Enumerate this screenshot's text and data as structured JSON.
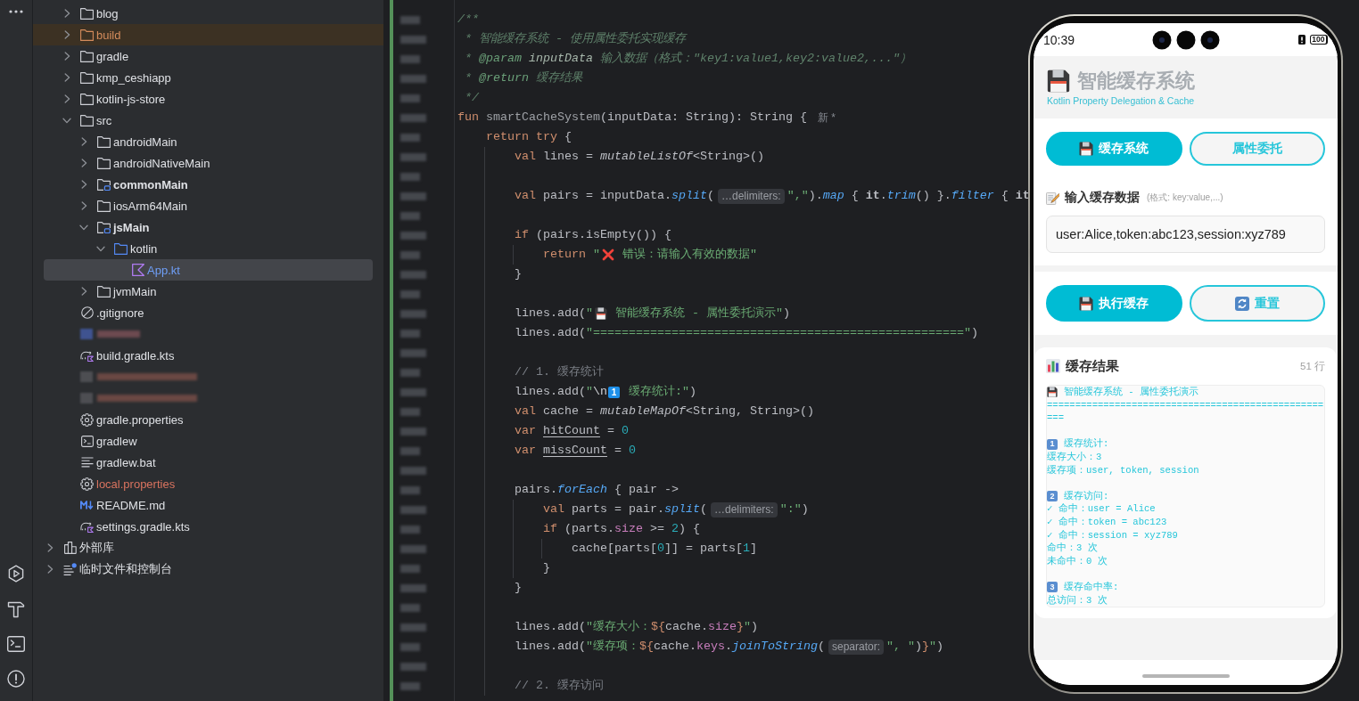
{
  "project_tree": {
    "project_contents": [
      {
        "label": "blog",
        "kind": "folder",
        "expanded": false,
        "selected": false,
        "highlighted": false
      },
      {
        "label": "build",
        "kind": "folder",
        "expanded": false,
        "selected": false,
        "highlighted": true,
        "color": "#d58c5c"
      },
      {
        "label": "gradle",
        "kind": "folder",
        "expanded": false,
        "selected": false,
        "highlighted": false
      },
      {
        "label": "kmp_ceshiapp",
        "kind": "folder",
        "expanded": false,
        "selected": false,
        "highlighted": false
      },
      {
        "label": "kotlin-js-store",
        "kind": "folder",
        "expanded": false,
        "selected": false,
        "highlighted": false
      },
      {
        "label": "src",
        "kind": "folder",
        "expanded": true,
        "selected": false,
        "highlighted": false,
        "children": [
          {
            "label": "androidMain",
            "kind": "folder",
            "expanded": false,
            "selected": false,
            "highlighted": false
          },
          {
            "label": "androidNativeMain",
            "kind": "folder",
            "expanded": false,
            "selected": false,
            "highlighted": false
          },
          {
            "label": "commonMain",
            "kind": "source_root",
            "expanded": false,
            "selected": false,
            "highlighted": false
          },
          {
            "label": "iosArm64Main",
            "kind": "folder",
            "expanded": false,
            "selected": false,
            "highlighted": false
          },
          {
            "label": "jsMain",
            "kind": "source_root",
            "expanded": true,
            "selected": false,
            "highlighted": false,
            "children": [
              {
                "label": "kotlin",
                "kind": "kotlin_folder",
                "expanded": true,
                "selected": false,
                "highlighted": false,
                "children": [
                  {
                    "label": "App.kt",
                    "kind": "kotlin_file",
                    "selected": true,
                    "highlighted": false,
                    "color": "#6f9ff8"
                  }
                ]
              }
            ]
          },
          {
            "label": "jvmMain",
            "kind": "folder",
            "expanded": false,
            "selected": false,
            "highlighted": false
          }
        ]
      },
      {
        "label": ".gitignore",
        "kind": "ignore_file",
        "selected": false,
        "highlighted": false
      },
      {
        "kind": "redacted",
        "selected": false,
        "highlighted": false
      },
      {
        "label": "build.gradle.kts",
        "kind": "gradle_script",
        "selected": false,
        "highlighted": false
      },
      {
        "kind": "redacted",
        "selected": false,
        "highlighted": false
      },
      {
        "kind": "redacted",
        "selected": false,
        "highlighted": false
      },
      {
        "label": "gradle.properties",
        "kind": "properties",
        "selected": false,
        "highlighted": false
      },
      {
        "label": "gradlew",
        "kind": "shell_script",
        "selected": false,
        "highlighted": false
      },
      {
        "label": "gradlew.bat",
        "kind": "batch_file",
        "selected": false,
        "highlighted": false
      },
      {
        "label": "local.properties",
        "kind": "properties",
        "selected": false,
        "highlighted": false,
        "color": "#d9735f"
      },
      {
        "label": "README.md",
        "kind": "markdown",
        "selected": false,
        "highlighted": false
      },
      {
        "label": "settings.gradle.kts",
        "kind": "gradle_script",
        "selected": false,
        "highlighted": false
      }
    ],
    "items": [
      {
        "label": "外部库",
        "kind": "library",
        "expanded": false,
        "selected": false,
        "highlighted": false
      },
      {
        "label": "临时文件和控制台",
        "kind": "scratches",
        "expanded": false,
        "selected": false,
        "highlighted": false
      }
    ]
  },
  "editor": {
    "lines": [
      {
        "kind": "code",
        "segments": [
          {
            "kind": "doc",
            "text": "/**"
          }
        ]
      },
      {
        "kind": "code",
        "segments": [
          {
            "kind": "doc",
            "text": " * 智能缓存系统 - 使用属性委托实现缓存"
          }
        ]
      },
      {
        "kind": "code",
        "segments": [
          {
            "kind": "doc",
            "text": " * "
          },
          {
            "kind": "doc_tag",
            "text": "@param "
          },
          {
            "kind": "doc_param",
            "text": "inputData"
          },
          {
            "kind": "doc",
            "text": " 输入数据（格式：\"key1:value1,key2:value2,...\"）"
          }
        ]
      },
      {
        "kind": "code",
        "segments": [
          {
            "kind": "doc",
            "text": " * "
          },
          {
            "kind": "doc_tag",
            "text": "@return"
          },
          {
            "kind": "doc",
            "text": " 缓存结果"
          }
        ]
      },
      {
        "kind": "code",
        "segments": [
          {
            "kind": "doc",
            "text": " */"
          }
        ]
      },
      {
        "kind": "code",
        "segments": [
          {
            "kind": "keyword",
            "text": "fun "
          },
          {
            "kind": "fn_decl",
            "text": "smartCacheSystem"
          },
          {
            "kind": "plain",
            "text": "(inputData: String): String {"
          },
          {
            "kind": "vision",
            "text": "新 *"
          }
        ]
      },
      {
        "kind": "code",
        "segments": [
          {
            "kind": "keyword",
            "text": "    return try"
          },
          {
            "kind": "plain",
            "text": " {"
          }
        ]
      },
      {
        "kind": "code",
        "segments": [
          {
            "kind": "keyword",
            "text": "        val"
          },
          {
            "kind": "plain",
            "text": " lines = "
          },
          {
            "kind": "std_call",
            "text": "mutableListOf"
          },
          {
            "kind": "plain",
            "text": "<String>()"
          }
        ]
      },
      {
        "kind": "blank"
      },
      {
        "kind": "code",
        "segments": [
          {
            "kind": "keyword",
            "text": "        val"
          },
          {
            "kind": "plain",
            "text": " pairs = inputData."
          },
          {
            "kind": "call",
            "text": "split"
          },
          {
            "kind": "plain",
            "text": "("
          },
          {
            "kind": "hint",
            "text": "…delimiters:"
          },
          {
            "kind": "string",
            "text": "\",\""
          },
          {
            "kind": "plain",
            "text": ")."
          },
          {
            "kind": "call",
            "text": "map"
          },
          {
            "kind": "plain",
            "text": " { "
          },
          {
            "kind": "it",
            "text": "it"
          },
          {
            "kind": "plain",
            "text": "."
          },
          {
            "kind": "call",
            "text": "trim"
          },
          {
            "kind": "plain",
            "text": "() }."
          },
          {
            "kind": "call",
            "text": "filter"
          },
          {
            "kind": "plain",
            "text": " { "
          },
          {
            "kind": "it",
            "text": "it"
          }
        ]
      },
      {
        "kind": "blank"
      },
      {
        "kind": "code",
        "segments": [
          {
            "kind": "keyword",
            "text": "        if"
          },
          {
            "kind": "plain",
            "text": " (pairs.isEmpty()) {"
          }
        ]
      },
      {
        "kind": "code",
        "segments": [
          {
            "kind": "keyword",
            "text": "            return "
          },
          {
            "kind": "string",
            "text": "\""
          },
          {
            "kind": "cross"
          },
          {
            "kind": "string",
            "text": " 错误：请输入有效的数据\""
          }
        ]
      },
      {
        "kind": "code",
        "segments": [
          {
            "kind": "plain",
            "text": "        }"
          }
        ]
      },
      {
        "kind": "blank"
      },
      {
        "kind": "code",
        "segments": [
          {
            "kind": "plain",
            "text": "        lines.add("
          },
          {
            "kind": "string",
            "text": "\""
          },
          {
            "kind": "floppy"
          },
          {
            "kind": "string",
            "text": " 智能缓存系统 - 属性委托演示\""
          },
          {
            "kind": "plain",
            "text": ")"
          }
        ]
      },
      {
        "kind": "code",
        "segments": [
          {
            "kind": "plain",
            "text": "        lines.add("
          },
          {
            "kind": "string",
            "text": "\"====================================================\""
          },
          {
            "kind": "plain",
            "text": ")"
          }
        ]
      },
      {
        "kind": "blank"
      },
      {
        "kind": "code",
        "segments": [
          {
            "kind": "comment",
            "text": "        // 1. 缓存统计"
          }
        ]
      },
      {
        "kind": "code",
        "segments": [
          {
            "kind": "plain",
            "text": "        lines.add("
          },
          {
            "kind": "string",
            "text": "\""
          },
          {
            "kind": "escape",
            "text": "\\n"
          },
          {
            "kind": "keycap",
            "text": "1"
          },
          {
            "kind": "string",
            "text": " 缓存统计:\""
          },
          {
            "kind": "plain",
            "text": ")"
          }
        ]
      },
      {
        "kind": "code",
        "segments": [
          {
            "kind": "keyword",
            "text": "        val"
          },
          {
            "kind": "plain",
            "text": " cache = "
          },
          {
            "kind": "std_call",
            "text": "mutableMapOf"
          },
          {
            "kind": "plain",
            "text": "<String, String>()"
          }
        ]
      },
      {
        "kind": "code",
        "segments": [
          {
            "kind": "keyword",
            "text": "        var "
          },
          {
            "kind": "mut_var",
            "text": "hitCount"
          },
          {
            "kind": "plain",
            "text": " = "
          },
          {
            "kind": "number",
            "text": "0"
          }
        ]
      },
      {
        "kind": "code",
        "segments": [
          {
            "kind": "keyword",
            "text": "        var "
          },
          {
            "kind": "mut_var",
            "text": "missCount"
          },
          {
            "kind": "plain",
            "text": " = "
          },
          {
            "kind": "number",
            "text": "0"
          }
        ]
      },
      {
        "kind": "blank"
      },
      {
        "kind": "code",
        "segments": [
          {
            "kind": "plain",
            "text": "        pairs."
          },
          {
            "kind": "call",
            "text": "forEach"
          },
          {
            "kind": "plain",
            "text": " { pair ->"
          }
        ]
      },
      {
        "kind": "code",
        "segments": [
          {
            "kind": "keyword",
            "text": "            val"
          },
          {
            "kind": "plain",
            "text": " parts = pair."
          },
          {
            "kind": "call",
            "text": "split"
          },
          {
            "kind": "plain",
            "text": "("
          },
          {
            "kind": "hint",
            "text": "…delimiters:"
          },
          {
            "kind": "string",
            "text": "\":\""
          },
          {
            "kind": "plain",
            "text": ")"
          }
        ]
      },
      {
        "kind": "code",
        "segments": [
          {
            "kind": "keyword",
            "text": "            if"
          },
          {
            "kind": "plain",
            "text": " (parts."
          },
          {
            "kind": "prop",
            "text": "size"
          },
          {
            "kind": "plain",
            "text": " >= "
          },
          {
            "kind": "number",
            "text": "2"
          },
          {
            "kind": "plain",
            "text": ") {"
          }
        ]
      },
      {
        "kind": "code",
        "segments": [
          {
            "kind": "plain",
            "text": "                cache[parts["
          },
          {
            "kind": "number",
            "text": "0"
          },
          {
            "kind": "plain",
            "text": "]] = parts["
          },
          {
            "kind": "number",
            "text": "1"
          },
          {
            "kind": "plain",
            "text": "]"
          }
        ]
      },
      {
        "kind": "code",
        "segments": [
          {
            "kind": "plain",
            "text": "            }"
          }
        ]
      },
      {
        "kind": "code",
        "segments": [
          {
            "kind": "plain",
            "text": "        }"
          }
        ]
      },
      {
        "kind": "blank"
      },
      {
        "kind": "code",
        "segments": [
          {
            "kind": "plain",
            "text": "        lines.add("
          },
          {
            "kind": "string",
            "text": "\"缓存大小："
          },
          {
            "kind": "template",
            "text": "${"
          },
          {
            "kind": "plain",
            "text": "cache."
          },
          {
            "kind": "prop",
            "text": "size"
          },
          {
            "kind": "template",
            "text": "}"
          },
          {
            "kind": "string",
            "text": "\""
          },
          {
            "kind": "plain",
            "text": ")"
          }
        ]
      },
      {
        "kind": "code",
        "segments": [
          {
            "kind": "plain",
            "text": "        lines.add("
          },
          {
            "kind": "string",
            "text": "\"缓存项："
          },
          {
            "kind": "template",
            "text": "${"
          },
          {
            "kind": "plain",
            "text": "cache."
          },
          {
            "kind": "prop",
            "text": "keys"
          },
          {
            "kind": "plain",
            "text": "."
          },
          {
            "kind": "call",
            "text": "joinToString"
          },
          {
            "kind": "plain",
            "text": "("
          },
          {
            "kind": "hint",
            "text": "separator:"
          },
          {
            "kind": "string",
            "text": "\", \""
          },
          {
            "kind": "plain",
            "text": ")"
          },
          {
            "kind": "template",
            "text": "}"
          },
          {
            "kind": "string",
            "text": "\""
          },
          {
            "kind": "plain",
            "text": ")"
          }
        ]
      },
      {
        "kind": "blank"
      },
      {
        "kind": "code",
        "segments": [
          {
            "kind": "comment",
            "text": "        // 2. 缓存访问"
          }
        ]
      }
    ]
  },
  "emulator": {
    "status_bar": {
      "time": "10:39",
      "battery": "100"
    },
    "header": {
      "title": "智能缓存系统",
      "subtitle": "Kotlin Property Delegation & Cache"
    },
    "tabs": [
      {
        "label": "缓存系统",
        "selected": true
      },
      {
        "label": "属性委托",
        "selected": false
      }
    ],
    "input": {
      "label": "输入缓存数据",
      "format_note": "(格式: key:value,...)",
      "value": "user:Alice,token:abc123,session:xyz789"
    },
    "actions": [
      {
        "label": "执行缓存",
        "kind": "primary"
      },
      {
        "label": "重置",
        "kind": "secondary"
      }
    ],
    "results": {
      "title": "缓存结果",
      "count": "51 行",
      "lines": [
        {
          "kind": "floppy",
          "text": "智能缓存系统 - 属性委托演示"
        },
        {
          "kind": "plain",
          "text": "===================================================="
        },
        {
          "kind": "blank"
        },
        {
          "kind": "keycap",
          "key": "1",
          "text": "缓存统计:"
        },
        {
          "kind": "plain",
          "text": "缓存大小：3"
        },
        {
          "kind": "plain",
          "text": "缓存项：user, token, session"
        },
        {
          "kind": "blank"
        },
        {
          "kind": "keycap",
          "key": "2",
          "text": "缓存访问:"
        },
        {
          "kind": "plain",
          "text": "✓ 命中：user = Alice"
        },
        {
          "kind": "plain",
          "text": "✓ 命中：token = abc123"
        },
        {
          "kind": "plain",
          "text": "✓ 命中：session = xyz789"
        },
        {
          "kind": "plain",
          "text": "命中：3 次"
        },
        {
          "kind": "plain",
          "text": "未命中：0 次"
        },
        {
          "kind": "blank"
        },
        {
          "kind": "keycap",
          "key": "3",
          "text": "缓存命中率:"
        },
        {
          "kind": "plain",
          "text": "总访问：3 次"
        }
      ]
    }
  }
}
